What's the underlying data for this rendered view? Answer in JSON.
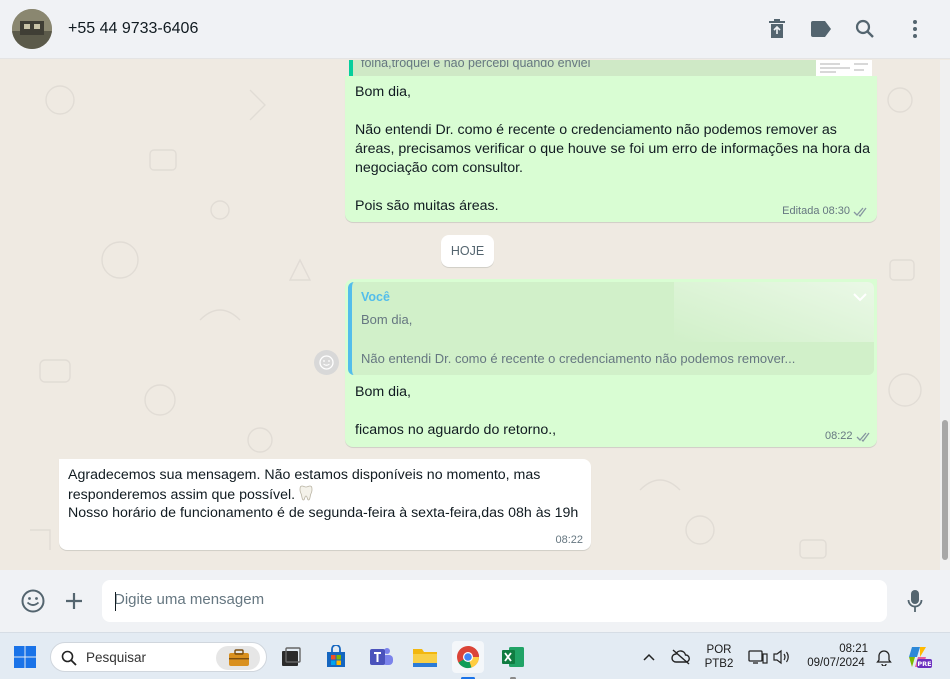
{
  "header": {
    "title": "+55 44 9733-6406"
  },
  "messages": {
    "top_quote_snippet": "folha,troquei e não percebi quando enviei",
    "msg1": {
      "line1": "Bom dia,",
      "line2": "Não entendi Dr. como é recente o credenciamento não podemos remover as",
      "line3": "áreas, precisamos verificar o que houve se foi um erro de informações na hora da",
      "line4": "negociação com consultor.",
      "line5": "Pois são muitas áreas.",
      "edited": "Editada",
      "time": "08:30"
    },
    "day_divider": "HOJE",
    "msg2": {
      "quote_author": "Você",
      "quote_line1": "Bom dia,",
      "quote_line2": "Não entendi Dr. como é recente o credenciamento não podemos remover...",
      "line1": "Bom dia,",
      "line2": "ficamos no aguardo do retorno.,",
      "time": "08:22"
    },
    "msg3": {
      "line1": "Agradecemos sua mensagem. Não estamos disponíveis no momento, mas",
      "line2": "responderemos assim que possível.",
      "line3": "Nosso horário de funcionamento  é de segunda-feira à sexta-feira,das 08h às 19h",
      "time": "08:22"
    }
  },
  "composer": {
    "placeholder": "Digite uma mensagem"
  },
  "taskbar": {
    "search_label": "Pesquisar",
    "lang_line1": "POR",
    "lang_line2": "PTB2",
    "time": "08:21",
    "date": "09/07/2024",
    "copilot_badge": "PRE"
  },
  "colors": {
    "outgoing_bubble": "#d9fdd3",
    "incoming_bubble": "#ffffff",
    "quote_author": "#53bdeb",
    "chat_bg": "#efeae2",
    "read_ticks": "#8696a0"
  }
}
